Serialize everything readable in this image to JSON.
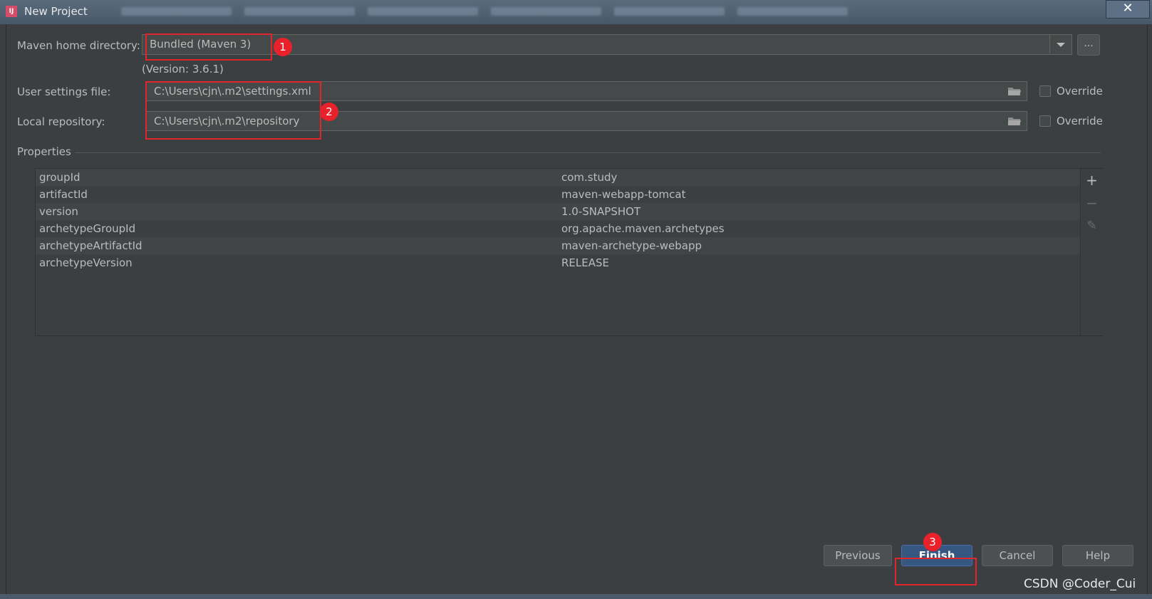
{
  "window": {
    "title": "New Project",
    "close_label": "✕"
  },
  "maven": {
    "home_label": "Maven home directory:",
    "home_value": "Bundled (Maven 3)",
    "version": "(Version: 3.6.1)",
    "browse_label": "...",
    "settings_label": "User settings file:",
    "settings_value": "C:\\Users\\cjn\\.m2\\settings.xml",
    "repo_label": "Local repository:",
    "repo_value": "C:\\Users\\cjn\\.m2\\repository",
    "override_label": "Override"
  },
  "properties": {
    "title": "Properties",
    "rows": [
      {
        "key": "groupId",
        "value": "com.study"
      },
      {
        "key": "artifactId",
        "value": "maven-webapp-tomcat"
      },
      {
        "key": "version",
        "value": "1.0-SNAPSHOT"
      },
      {
        "key": "archetypeGroupId",
        "value": "org.apache.maven.archetypes"
      },
      {
        "key": "archetypeArtifactId",
        "value": "maven-archetype-webapp"
      },
      {
        "key": "archetypeVersion",
        "value": "RELEASE"
      }
    ],
    "tools": [
      "+",
      "−",
      "✎"
    ]
  },
  "annotations": [
    "1",
    "2",
    "3"
  ],
  "buttons": {
    "previous": "Previous",
    "finish": "Finish",
    "cancel": "Cancel",
    "help": "Help"
  },
  "watermark": "CSDN @Coder_Cui",
  "colors": {
    "background": "#3c3f41",
    "field": "#45494a",
    "primary_button": "#365880",
    "annotation_red": "#e0262b"
  }
}
